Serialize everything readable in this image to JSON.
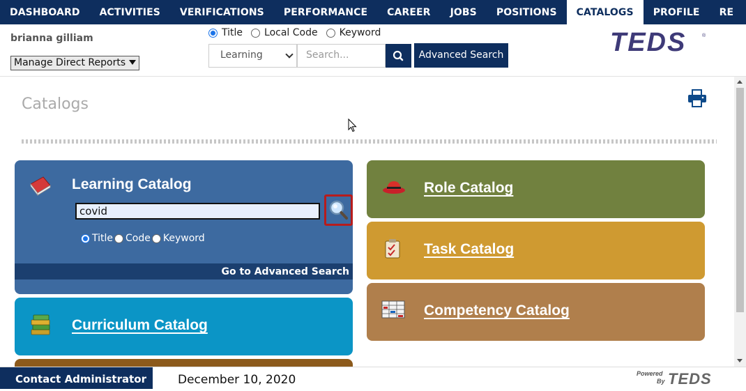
{
  "nav": {
    "items": [
      {
        "label": "DASHBOARD",
        "active": false
      },
      {
        "label": "ACTIVITIES",
        "active": false
      },
      {
        "label": "VERIFICATIONS",
        "active": false
      },
      {
        "label": "PERFORMANCE",
        "active": false
      },
      {
        "label": "CAREER",
        "active": false
      },
      {
        "label": "JOBS",
        "active": false
      },
      {
        "label": "POSITIONS",
        "active": false
      },
      {
        "label": "CATALOGS",
        "active": true
      },
      {
        "label": "PROFILE",
        "active": false
      },
      {
        "label": "RE",
        "active": false
      }
    ]
  },
  "header": {
    "user_name": "brianna gilliam",
    "reports_select": "Manage Direct Reports",
    "search_mode": {
      "options": [
        "Title",
        "Local Code",
        "Keyword"
      ],
      "selected": "Title"
    },
    "catalog_select": "Learning",
    "search_placeholder": "Search...",
    "advanced_search_label": "Advanced Search",
    "logo_text": "TEDS"
  },
  "page": {
    "title": "Catalogs"
  },
  "catalogs": {
    "learning": {
      "title": "Learning Catalog",
      "search_value": "covid",
      "radio_options": [
        "Title",
        "Code",
        "Keyword"
      ],
      "radio_selected": "Title",
      "advanced_link": "Go to Advanced Search",
      "color": "#3d6aa0"
    },
    "curriculum": {
      "title": "Curriculum Catalog",
      "color": "#0b95c6"
    },
    "role": {
      "title": "Role Catalog",
      "color": "#71813f"
    },
    "task": {
      "title": "Task Catalog",
      "color": "#cf9a31"
    },
    "competency": {
      "title": "Competency Catalog",
      "color": "#b07f4c"
    }
  },
  "footer": {
    "contact_label": "Contact Administrator",
    "date": "December 10, 2020",
    "powered_label": "Powered By",
    "powered_logo": "TEDS"
  },
  "colors": {
    "brand_navy": "#0e2e5e",
    "highlight_red": "#b71c1c"
  }
}
